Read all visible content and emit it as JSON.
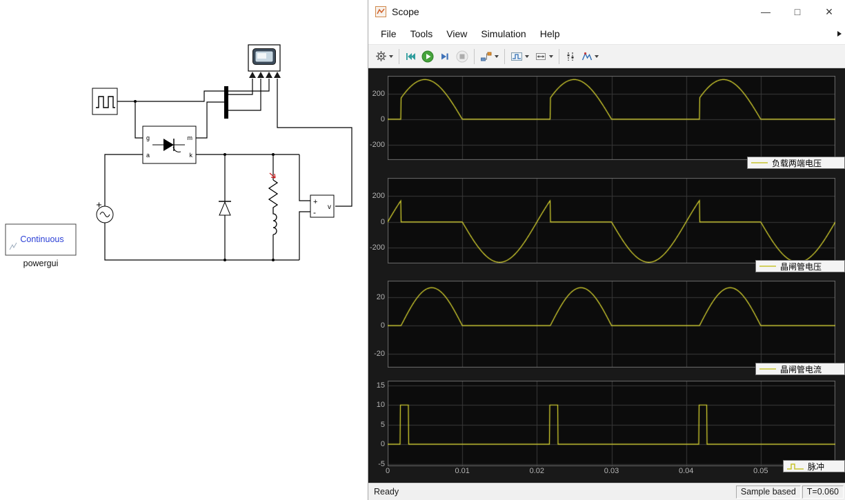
{
  "model": {
    "powergui": {
      "label": "Continuous",
      "name": "powergui"
    },
    "thyristor": {
      "port_g": "g",
      "port_a": "a",
      "port_m": "m",
      "port_k": "k"
    },
    "voltmeter": {
      "plus": "+",
      "minus": "-",
      "output": "v"
    }
  },
  "scope": {
    "title": "Scope",
    "window_buttons": {
      "minimize": "—",
      "maximize": "□",
      "close": "×"
    },
    "menus": [
      "File",
      "Tools",
      "View",
      "Simulation",
      "Help"
    ],
    "toolbar_icons": [
      "settings-gear",
      "step-back",
      "run",
      "step-forward",
      "stop",
      "highlight-source-block",
      "trigger",
      "span",
      "cursor-measurements",
      "peak-finder"
    ],
    "status": {
      "ready": "Ready",
      "sample_mode": "Sample based",
      "time": "T=0.060"
    },
    "chart_type": "line",
    "xlim": [
      0,
      0.06
    ],
    "xticks": [
      0,
      0.01,
      0.02,
      0.03,
      0.04,
      0.05
    ],
    "trace_color": "#e6e232",
    "plots": [
      {
        "name": "load-voltage",
        "legend": "负载两端电压",
        "yticks": [
          200,
          0,
          -200
        ],
        "ylim": [
          -320,
          340
        ],
        "waveform": {
          "kind": "gated-sine",
          "amplitude": 311,
          "period": 0.02,
          "fire": 0.0018,
          "end": 0.01
        }
      },
      {
        "name": "thyristor-voltage",
        "legend": "晶闸管电压",
        "yticks": [
          200,
          0,
          -200
        ],
        "ylim": [
          -320,
          340
        ],
        "waveform": {
          "kind": "thyristor-voltage",
          "amplitude": 311,
          "period": 0.02,
          "fire": 0.0018,
          "conduct_end": 0.01
        }
      },
      {
        "name": "thyristor-current",
        "legend": "晶闸管电流",
        "yticks": [
          20,
          0,
          -20
        ],
        "ylim": [
          -30,
          32
        ],
        "waveform": {
          "kind": "half-sine",
          "amplitude": 27,
          "period": 0.02,
          "fire": 0.0018,
          "end": 0.01
        }
      },
      {
        "name": "pulse",
        "legend": "脉冲",
        "yticks": [
          15,
          10,
          5,
          0,
          -5
        ],
        "ylim": [
          -5.6,
          16.2
        ],
        "waveform": {
          "kind": "pulse",
          "amplitude": 10,
          "period": 0.02,
          "start": 0.0017,
          "width": 0.0011
        }
      }
    ]
  }
}
